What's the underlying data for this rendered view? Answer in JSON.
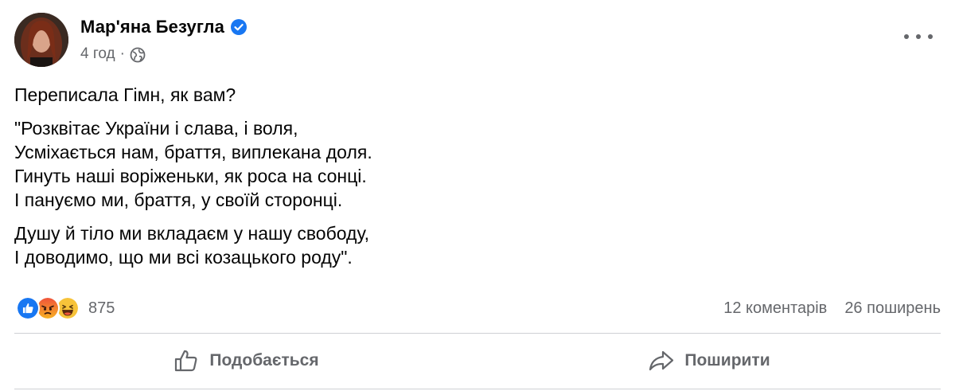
{
  "post": {
    "author": {
      "name": "Мар'яна Безугла",
      "verified": true,
      "avatar_icon": "profile-photo"
    },
    "meta": {
      "time": "4 год",
      "separator": "·",
      "privacy_icon": "globe-icon"
    },
    "text": {
      "intro": "Переписала Гімн, як вам?",
      "stanza1": [
        "\"Розквітає України і слава, і воля,",
        "Усміхається нам, браття, виплекана доля.",
        "Гинуть наші воріженьки, як роса на сонці.",
        "І пануємо ми, браття, у своїй сторонці."
      ],
      "stanza2": [
        "Душу й тіло ми вкладаєм у нашу свободу,",
        "І доводимо, що ми всі козацького роду\"."
      ]
    },
    "reactions": {
      "types": [
        "like",
        "angry",
        "haha"
      ],
      "count": "875"
    },
    "stats": {
      "comments": "12 коментарів",
      "shares": "26 поширень"
    },
    "actions": {
      "like_label": "Подобається",
      "share_label": "Поширити"
    },
    "colors": {
      "text": "#050505",
      "secondary": "#65676b",
      "verified_blue": "#1877f2",
      "divider": "#ced0d4"
    }
  }
}
